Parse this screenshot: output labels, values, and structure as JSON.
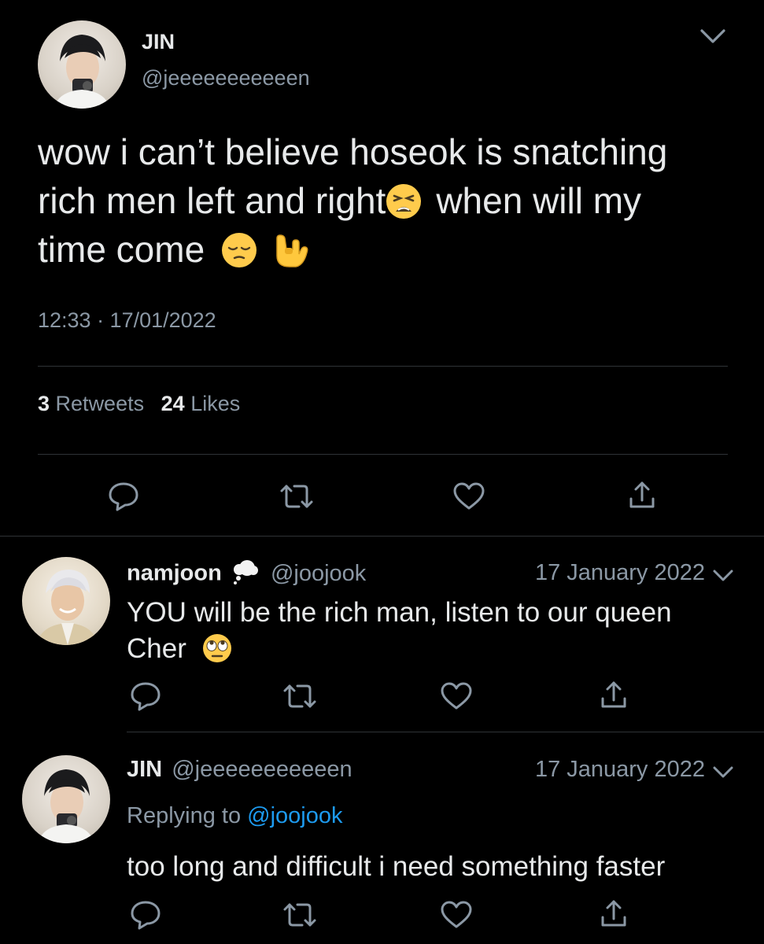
{
  "main_tweet": {
    "display_name": "JIN",
    "handle": "@jeeeeeeeeeeen",
    "text_line1": "wow i can’t believe hoseok is snatching",
    "text_line2a": "rich men left and right",
    "text_line2b": "when will my",
    "text_line3": "time come",
    "timestamp": "12:33 · 17/01/2022",
    "retweet_count": "3",
    "retweet_label": "Retweets",
    "like_count": "24",
    "like_label": "Likes"
  },
  "replies": [
    {
      "display_name": "namjoon",
      "handle": "@joojook",
      "date": "17 January 2022",
      "text_line1": "YOU will be the rich man, listen to our queen",
      "text_line2": "Cher"
    },
    {
      "display_name": "JIN",
      "handle": "@jeeeeeeeeeeen",
      "date": "17 January 2022",
      "replying_prefix": "Replying to",
      "replying_handle": "@joojook",
      "text": "too long and difficult i need something faster"
    }
  ],
  "icons": [
    "reply-icon",
    "retweet-icon",
    "like-icon",
    "share-icon",
    "chevron-down-icon",
    "thought-balloon-emoji",
    "tired-face-emoji",
    "pensive-face-emoji",
    "love-you-gesture-emoji",
    "rolling-eyes-emoji"
  ],
  "colors": {
    "background": "#000000",
    "text": "#e7e9ea",
    "secondary": "#8b98a5",
    "link": "#1d9bf0",
    "divider": "#2f3336"
  }
}
